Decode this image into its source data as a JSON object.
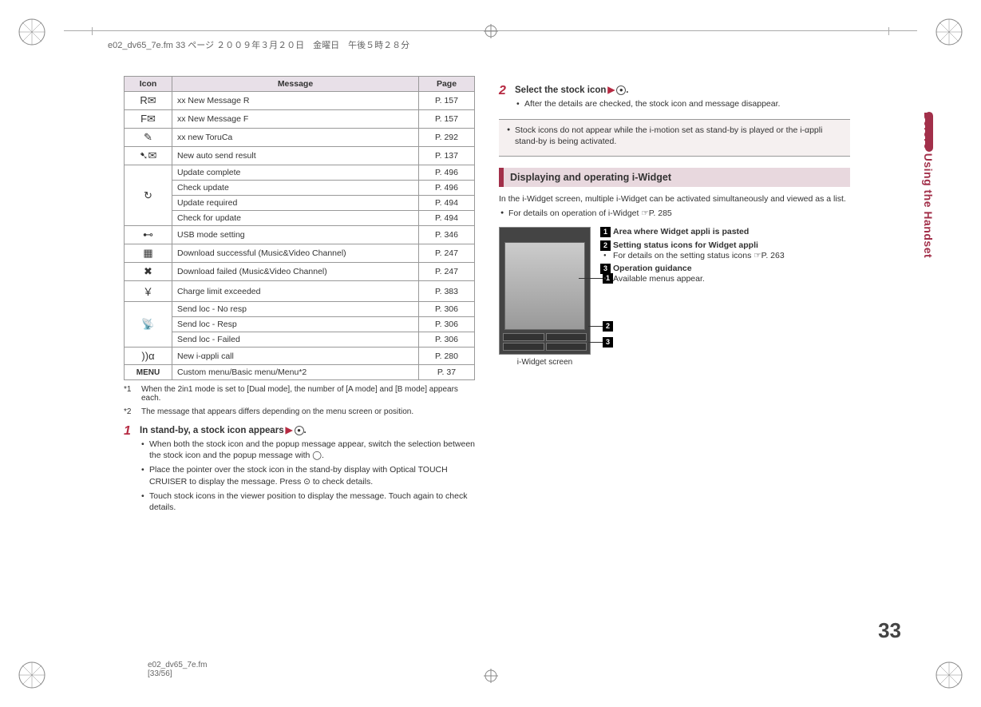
{
  "header": "e02_dv65_7e.fm  33 ページ  ２００９年３月２０日　金曜日　午後５時２８分",
  "table": {
    "headers": [
      "Icon",
      "Message",
      "Page"
    ],
    "rows": [
      {
        "icon": "R✉",
        "msg": "xx New Message R",
        "page": "P. 157"
      },
      {
        "icon": "F✉",
        "msg": "xx New Message F",
        "page": "P. 157"
      },
      {
        "icon": "✎",
        "msg": "xx new ToruCa",
        "page": "P. 292"
      },
      {
        "icon": "➷✉",
        "msg": "New auto send result",
        "page": "P. 137"
      },
      {
        "icon": "↻",
        "msg": "Update complete",
        "page": "P. 496",
        "rowspan": 4
      },
      {
        "msg": "Check update",
        "page": "P. 496"
      },
      {
        "msg": "Update required",
        "page": "P. 494"
      },
      {
        "msg": "Check for update",
        "page": "P. 494"
      },
      {
        "icon": "⊷",
        "msg": "USB mode setting",
        "page": "P. 346"
      },
      {
        "icon": "▦",
        "msg": "Download successful (Music&Video Channel)",
        "page": "P. 247"
      },
      {
        "icon": "✖",
        "msg": "Download failed (Music&Video Channel)",
        "page": "P. 247"
      },
      {
        "icon": "￥",
        "msg": "Charge limit exceeded",
        "page": "P. 383"
      },
      {
        "icon": "📡",
        "msg": "Send loc - No resp",
        "page": "P. 306",
        "rowspan": 3
      },
      {
        "msg": "Send loc - Resp",
        "page": "P. 306"
      },
      {
        "msg": "Send loc - Failed",
        "page": "P. 306"
      },
      {
        "icon": "))α",
        "msg": "New i-αppli call",
        "page": "P. 280"
      },
      {
        "icon": "MENU",
        "msg": "Custom menu/Basic menu/Menu*2",
        "page": "P. 37"
      }
    ]
  },
  "footnotes": [
    {
      "num": "*1",
      "text": "When the 2in1 mode is set to [Dual mode], the number of [A mode] and [B mode] appears each."
    },
    {
      "num": "*2",
      "text": "The message that appears differs depending on the menu screen or position."
    }
  ],
  "step1": {
    "num": "1",
    "title_a": "In stand-by, a stock icon appears",
    "title_b": ".",
    "bullets": [
      "When both the stock icon and the popup message appear, switch the selection between the stock icon and the popup message with ◯.",
      "Place the pointer over the stock icon in the stand-by display with Optical TOUCH CRUISER to display the message. Press ⊙ to check details.",
      "Touch stock icons in the viewer position to display the message. Touch again to check details."
    ]
  },
  "step2": {
    "num": "2",
    "title_a": "Select the stock icon",
    "title_b": ".",
    "bullet": "After the details are checked, the stock icon and message disappear."
  },
  "note": "Stock icons do not appear while the i-motion set as stand-by is played or the i-αppli stand-by is being activated.",
  "section_heading": "Displaying and operating i-Widget",
  "widget_intro": "In the i-Widget screen, multiple i-Widget can be activated simultaneously and viewed as a list.",
  "widget_ref": "For details on operation of i-Widget ☞P. 285",
  "widget_caption": "i-Widget screen",
  "widget_items": [
    {
      "num": "1",
      "title": "Area where Widget appli is pasted"
    },
    {
      "num": "2",
      "title": "Setting status icons for Widget appli",
      "sub": "For details on the setting status icons ☞P. 263"
    },
    {
      "num": "3",
      "title": "Operation guidance",
      "sub": "Available menus appear."
    }
  ],
  "side_tab": "Before Using the Handset",
  "page_num": "33",
  "footer_a": "e02_dv65_7e.fm",
  "footer_b": "[33/56]"
}
